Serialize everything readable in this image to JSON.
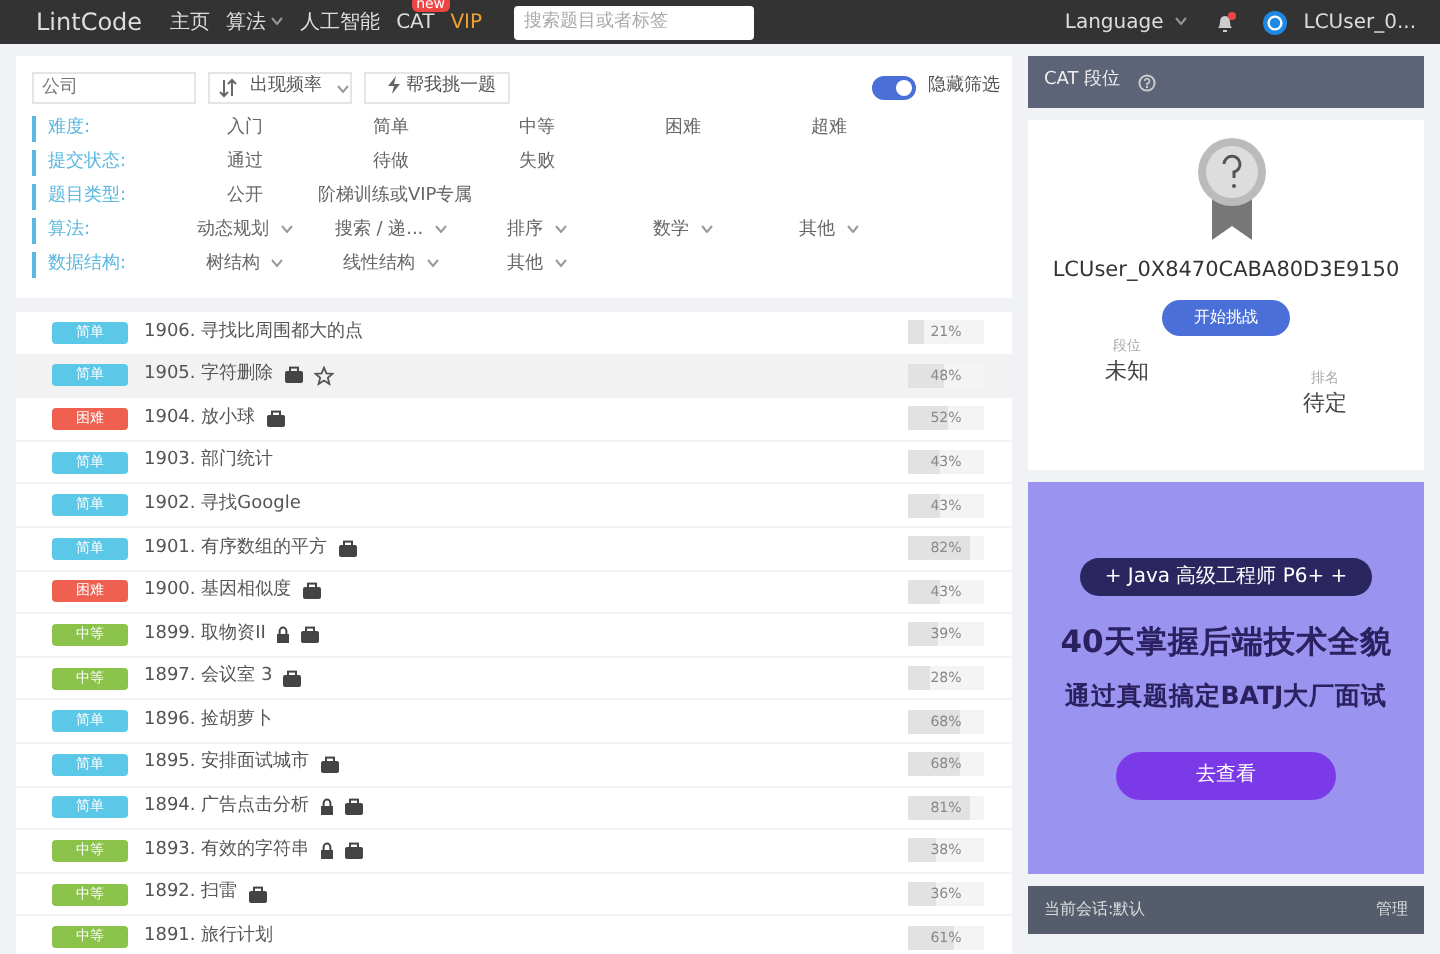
{
  "navbar": {
    "logo": "LintCode",
    "links": [
      {
        "label": "主页",
        "dropdown": false
      },
      {
        "label": "算法",
        "dropdown": true
      },
      {
        "label": "人工智能",
        "dropdown": false
      },
      {
        "label": "CAT",
        "dropdown": false,
        "badge": "new"
      },
      {
        "label": "VIP",
        "dropdown": false,
        "kind": "vip"
      }
    ],
    "search": {
      "placeholder": "搜索题目或者标签"
    },
    "language": "Language",
    "notification_dot": true,
    "user": "LCUser_0..."
  },
  "toolbar": {
    "company": {
      "placeholder": "公司"
    },
    "sort": "出现频率",
    "pick_button": "帮我挑一题",
    "hide_filter": {
      "label": "隐藏筛选",
      "on": true
    }
  },
  "filters": [
    {
      "label": "难度:",
      "options": [
        {
          "label": "入门",
          "dropdown": false
        },
        {
          "label": "简单",
          "dropdown": false
        },
        {
          "label": "中等",
          "dropdown": false
        },
        {
          "label": "困难",
          "dropdown": false
        },
        {
          "label": "超难",
          "dropdown": false
        }
      ]
    },
    {
      "label": "提交状态:",
      "options": [
        {
          "label": "通过",
          "dropdown": false
        },
        {
          "label": "待做",
          "dropdown": false
        },
        {
          "label": "失败",
          "dropdown": false
        }
      ]
    },
    {
      "label": "题目类型:",
      "options": [
        {
          "label": "公开",
          "dropdown": false
        },
        {
          "label": "阶梯训练或VIP专属",
          "dropdown": false
        }
      ]
    },
    {
      "label": "算法:",
      "options": [
        {
          "label": "动态规划",
          "dropdown": true
        },
        {
          "label": "搜索 / 递...",
          "dropdown": true
        },
        {
          "label": "排序",
          "dropdown": true
        },
        {
          "label": "数学",
          "dropdown": true
        },
        {
          "label": "其他",
          "dropdown": true
        }
      ]
    },
    {
      "label": "数据结构:",
      "options": [
        {
          "label": "树结构",
          "dropdown": true
        },
        {
          "label": "线性结构",
          "dropdown": true
        },
        {
          "label": "其他",
          "dropdown": true
        }
      ]
    }
  ],
  "problems": [
    {
      "difficulty": "简单",
      "kind": "easy",
      "title": "1906. 寻找比周围都大的点",
      "locked": false,
      "enterprise": false,
      "star": false,
      "highlighted": false,
      "rate": "21%",
      "level": 0.21
    },
    {
      "difficulty": "简单",
      "kind": "easy",
      "title": "1905. 字符删除",
      "locked": false,
      "enterprise": true,
      "star": true,
      "highlighted": true,
      "rate": "48%",
      "level": 0.48
    },
    {
      "difficulty": "困难",
      "kind": "hard",
      "title": "1904. 放小球",
      "locked": false,
      "enterprise": true,
      "star": false,
      "highlighted": false,
      "rate": "52%",
      "level": 0.52
    },
    {
      "difficulty": "简单",
      "kind": "easy",
      "title": "1903. 部门统计",
      "locked": false,
      "enterprise": false,
      "star": false,
      "highlighted": false,
      "rate": "43%",
      "level": 0.43
    },
    {
      "difficulty": "简单",
      "kind": "easy",
      "title": "1902. 寻找Google",
      "locked": false,
      "enterprise": false,
      "star": false,
      "highlighted": false,
      "rate": "43%",
      "level": 0.43
    },
    {
      "difficulty": "简单",
      "kind": "easy",
      "title": "1901. 有序数组的平方",
      "locked": false,
      "enterprise": true,
      "star": false,
      "highlighted": false,
      "rate": "82%",
      "level": 0.82
    },
    {
      "difficulty": "困难",
      "kind": "hard",
      "title": "1900. 基因相似度",
      "locked": false,
      "enterprise": true,
      "star": false,
      "highlighted": false,
      "rate": "43%",
      "level": 0.43
    },
    {
      "difficulty": "中等",
      "kind": "medium",
      "title": "1899. 取物资II",
      "locked": true,
      "enterprise": true,
      "star": false,
      "highlighted": false,
      "rate": "39%",
      "level": 0.39
    },
    {
      "difficulty": "中等",
      "kind": "medium",
      "title": "1897. 会议室 3",
      "locked": false,
      "enterprise": true,
      "star": false,
      "highlighted": false,
      "rate": "28%",
      "level": 0.28
    },
    {
      "difficulty": "简单",
      "kind": "easy",
      "title": "1896. 捡胡萝卜",
      "locked": false,
      "enterprise": false,
      "star": false,
      "highlighted": false,
      "rate": "68%",
      "level": 0.68
    },
    {
      "difficulty": "简单",
      "kind": "easy",
      "title": "1895. 安排面试城市",
      "locked": false,
      "enterprise": true,
      "star": false,
      "highlighted": false,
      "rate": "68%",
      "level": 0.68
    },
    {
      "difficulty": "简单",
      "kind": "easy",
      "title": "1894. 广告点击分析",
      "locked": true,
      "enterprise": true,
      "star": false,
      "highlighted": false,
      "rate": "81%",
      "level": 0.81
    },
    {
      "difficulty": "中等",
      "kind": "medium",
      "title": "1893. 有效的字符串",
      "locked": true,
      "enterprise": true,
      "star": false,
      "highlighted": false,
      "rate": "38%",
      "level": 0.38
    },
    {
      "difficulty": "中等",
      "kind": "medium",
      "title": "1892. 扫雷",
      "locked": false,
      "enterprise": true,
      "star": false,
      "highlighted": false,
      "rate": "36%",
      "level": 0.36
    },
    {
      "difficulty": "中等",
      "kind": "medium",
      "title": "1891. 旅行计划",
      "locked": false,
      "enterprise": false,
      "star": false,
      "highlighted": false,
      "rate": "61%",
      "level": 0.61
    }
  ],
  "cat_panel": {
    "title": "CAT 段位",
    "username": "LCUser_0X8470CABA80D3E9150",
    "button": "开始挑战",
    "rank_label": "段位",
    "rank_value": "未知",
    "ranking_label": "排名",
    "ranking_value": "待定"
  },
  "ad": {
    "tag": "+ Java 高级工程师 P6+ +",
    "headline": "40天掌握后端技术全貌",
    "subline": "通过真题搞定BATJ大厂面试",
    "button": "去查看"
  },
  "session_bar": {
    "label": "当前会话:默认",
    "action": "管理"
  }
}
